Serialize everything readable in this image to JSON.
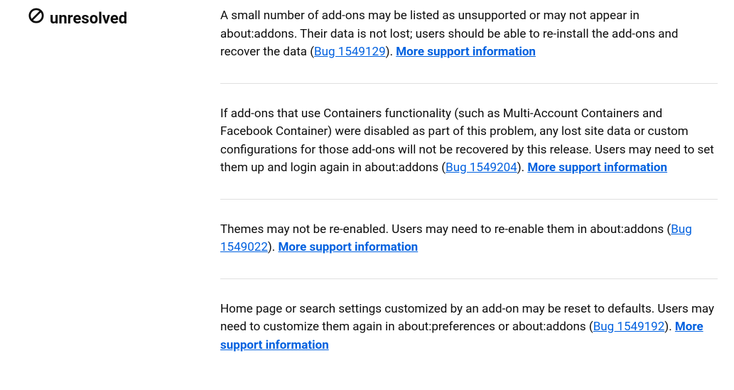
{
  "sidebar": {
    "status_label": "unresolved"
  },
  "notes": [
    {
      "segments": [
        {
          "type": "text",
          "t": "A small number of add-ons may be listed as unsupported or may not appear in about:addons. Their data is not lost; users should be able to re-install the add-ons and recover the data ("
        },
        {
          "type": "link",
          "t": "Bug 1549129"
        },
        {
          "type": "text",
          "t": "). "
        },
        {
          "type": "more",
          "t": "More support information"
        }
      ]
    },
    {
      "segments": [
        {
          "type": "text",
          "t": "If add-ons that use Containers functionality (such as Multi-Account Containers and Facebook Container) were disabled as part of this problem, any lost site data or custom configurations for those add-ons will not be recovered by this release. Users may need to set them up and login again in about:addons ("
        },
        {
          "type": "link",
          "t": "Bug 1549204"
        },
        {
          "type": "text",
          "t": "). "
        },
        {
          "type": "more",
          "t": "More support information"
        }
      ]
    },
    {
      "segments": [
        {
          "type": "text",
          "t": "Themes may not be re-enabled. Users may need to re-enable them in about:addons ("
        },
        {
          "type": "link",
          "t": "Bug 1549022"
        },
        {
          "type": "text",
          "t": "). "
        },
        {
          "type": "more",
          "t": "More support information"
        }
      ]
    },
    {
      "segments": [
        {
          "type": "text",
          "t": "Home page or search settings customized by an add-on may be reset to defaults. Users may need to customize them again in about:preferences or about:addons ("
        },
        {
          "type": "link",
          "t": "Bug 1549192"
        },
        {
          "type": "text",
          "t": "). "
        },
        {
          "type": "more",
          "t": "More support information"
        }
      ]
    }
  ]
}
